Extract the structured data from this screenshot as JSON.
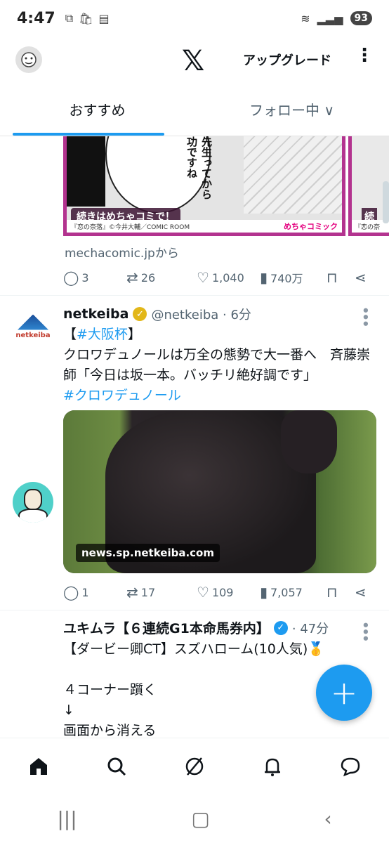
{
  "status": {
    "time": "4:47",
    "battery": "93"
  },
  "header": {
    "logo": "𝕏",
    "upgrade_label": "アップグレード"
  },
  "tabs": [
    {
      "label": "おすすめ"
    },
    {
      "label": "フォロー中 ∨"
    }
  ],
  "tweet1": {
    "manga_text": "先生ってから功ですね",
    "continue_label": "続きはめちゃコミで！",
    "credit": "『恋の奈落』©今井大輔／COMIC ROOM",
    "brand": "めちゃコミック",
    "continue_label2": "続",
    "credit2": "『恋の奈",
    "source": "mechacomic.jpから",
    "replies": "3",
    "retweets": "26",
    "likes": "1,040",
    "views": "740万"
  },
  "tweet2": {
    "name": "netkeiba",
    "handle": "@netkeiba · 6分",
    "avatar_text": "netkeiba",
    "line1_pre": "【",
    "line1_tag": "#大阪杯",
    "line1_post": "】",
    "body": "クロワデュノールは万全の態勢で大一番へ　斉藤崇師「今日は坂一本。バッチリ絶好調です」",
    "tag2": "#クロワデュノール",
    "card_source": "news.sp.netkeiba.com",
    "replies": "1",
    "retweets": "17",
    "likes": "109",
    "views": "7,057"
  },
  "tweet3": {
    "name": "ユキムラ【６連続G1本命馬券内】",
    "handle": "· 47分",
    "body": "【ダービー卿CT】スズハローム(10人気)🥇\n\n４コーナー躓く\n↓\n画面から消える"
  },
  "fab_label": "+"
}
